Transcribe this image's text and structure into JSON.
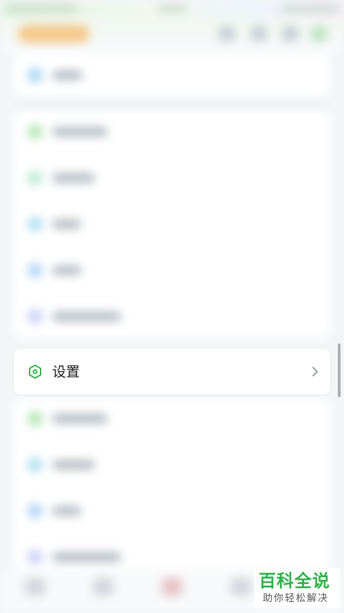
{
  "settings_item": {
    "label": "设置",
    "icon": "hexagon-settings-icon",
    "chevron": "chevron-right-icon",
    "accent_color": "#2fb24a"
  },
  "watermark": {
    "title": "百科全说",
    "subtitle": "助你轻松解决"
  },
  "colors": {
    "background": "#f3f5f7",
    "card": "#ffffff",
    "accent": "#2fb24a"
  }
}
